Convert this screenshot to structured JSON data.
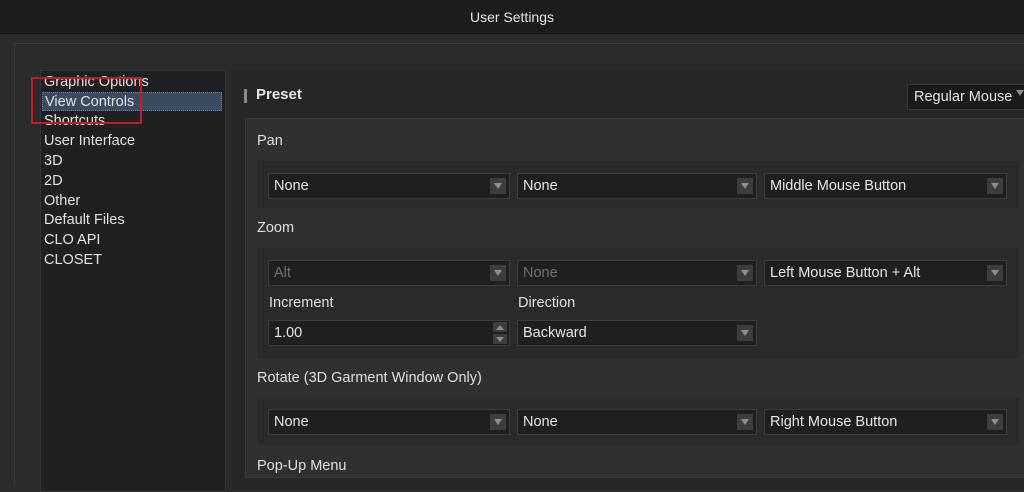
{
  "window": {
    "title": "User Settings"
  },
  "sidebar": {
    "items": [
      {
        "label": "Graphic Options"
      },
      {
        "label": "View Controls"
      },
      {
        "label": "Shortcuts"
      },
      {
        "label": "User Interface"
      },
      {
        "label": "3D"
      },
      {
        "label": "2D"
      },
      {
        "label": "Other"
      },
      {
        "label": "Default Files"
      },
      {
        "label": "CLO API"
      },
      {
        "label": "CLOSET"
      }
    ],
    "selected": "View Controls"
  },
  "preset": {
    "title": "Preset",
    "value": "Regular Mouse"
  },
  "pan": {
    "label": "Pan",
    "fields": [
      "None",
      "None",
      "Middle Mouse Button"
    ]
  },
  "zoom": {
    "label": "Zoom",
    "fields": [
      "Alt",
      "None",
      "Left Mouse Button + Alt"
    ],
    "increment_label": "Increment",
    "increment_value": "1.00",
    "direction_label": "Direction",
    "direction_value": "Backward"
  },
  "rotate": {
    "label": "Rotate (3D Garment Window Only)",
    "fields": [
      "None",
      "None",
      "Right Mouse Button"
    ]
  },
  "popup": {
    "label": "Pop-Up Menu"
  },
  "colors": {
    "highlight_border": "#c21d22",
    "selection": "#3b4a5e"
  }
}
